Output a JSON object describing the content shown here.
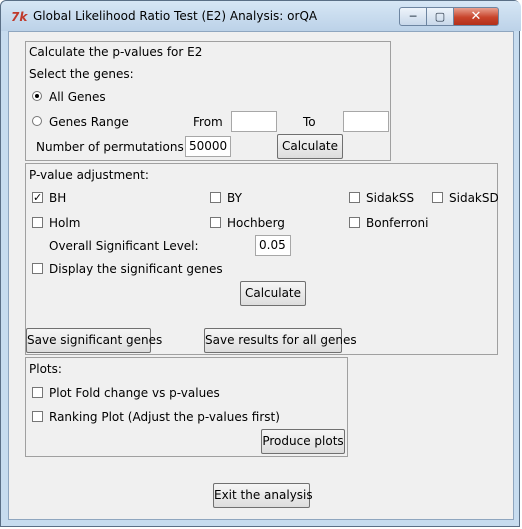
{
  "window": {
    "title": "Global Likelihood Ratio Test (E2) Analysis: orQA",
    "icon": "tk-feather-icon",
    "controls": {
      "minimize": "─",
      "maximize": "▢",
      "close": "✕"
    }
  },
  "pvalues": {
    "heading": "Calculate the p-values for E2",
    "select_label": "Select the genes:",
    "all_genes_label": "All Genes",
    "all_genes_selected": true,
    "genes_range_label": "Genes Range",
    "from_label": "From",
    "from_value": "",
    "to_label": "To",
    "to_value": "",
    "permutations_label": "Number of permutations:",
    "permutations_value": "50000",
    "calculate_label": "Calculate"
  },
  "adjustment": {
    "heading": "P-value adjustment:",
    "methods": [
      {
        "label": "BH",
        "checked": true
      },
      {
        "label": "BY",
        "checked": false
      },
      {
        "label": "SidakSS",
        "checked": false
      },
      {
        "label": "SidakSD",
        "checked": false
      },
      {
        "label": "Holm",
        "checked": false
      },
      {
        "label": "Hochberg",
        "checked": false
      },
      {
        "label": "Bonferroni",
        "checked": false
      }
    ],
    "level_label": "Overall Significant Level:",
    "level_value": "0.05",
    "display_label": "Display the significant genes",
    "display_checked": false,
    "calculate_label": "Calculate",
    "save_sig_label": "Save significant genes",
    "save_all_label": "Save results for all genes"
  },
  "plots": {
    "heading": "Plots:",
    "fold_label": "Plot Fold change vs p-values",
    "fold_checked": false,
    "ranking_label": "Ranking Plot (Adjust the p-values first)",
    "ranking_checked": false,
    "produce_label": "Produce plots"
  },
  "exit_label": "Exit the analysis"
}
